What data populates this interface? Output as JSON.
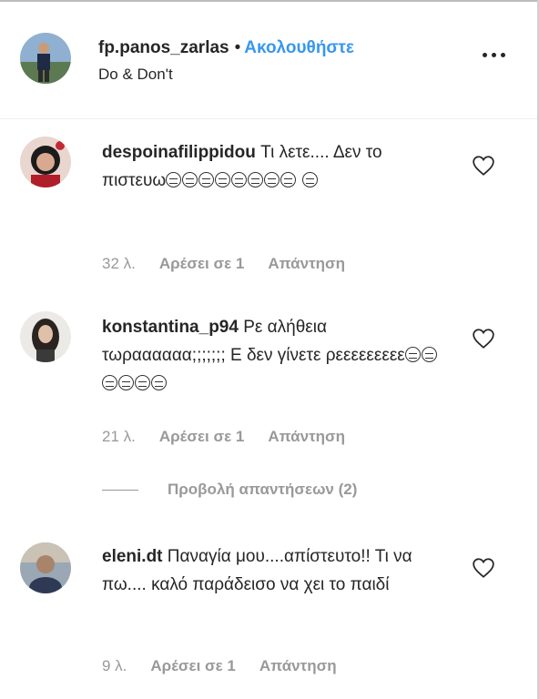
{
  "header": {
    "username": "fp.panos_zarlas",
    "separator": "•",
    "follow_label": "Ακολουθήστε",
    "subtitle": "Do & Don't",
    "more_icon": "more-horizontal-icon"
  },
  "comments": [
    {
      "username": "despoinafilippidou",
      "text": "Τι λετε.... Δεν το πιστευω",
      "emoji_count": 9,
      "time": "32 λ.",
      "likes": "Αρέσει σε 1",
      "reply": "Απάντηση"
    },
    {
      "username": "konstantina_p94",
      "text": "Ρε αλήθεια τωραααααα;;;;;;; Ε δεν γίνετε ρεεεεεεεεε",
      "emoji_count": 6,
      "time": "21 λ.",
      "likes": "Αρέσει σε 1",
      "reply": "Απάντηση"
    },
    {
      "username": "eleni.dt",
      "text": "Παναγία μου....απίστευτο!! Τι να πω.... καλό παράδεισο να χει το παιδί",
      "emoji_count": 0,
      "time": "9 λ.",
      "likes": "Αρέσει σε 1",
      "reply": "Απάντηση"
    }
  ],
  "view_replies": "Προβολή απαντήσεων (2)",
  "colors": {
    "accent": "#3897f0",
    "text": "#262626",
    "muted": "#999999"
  }
}
